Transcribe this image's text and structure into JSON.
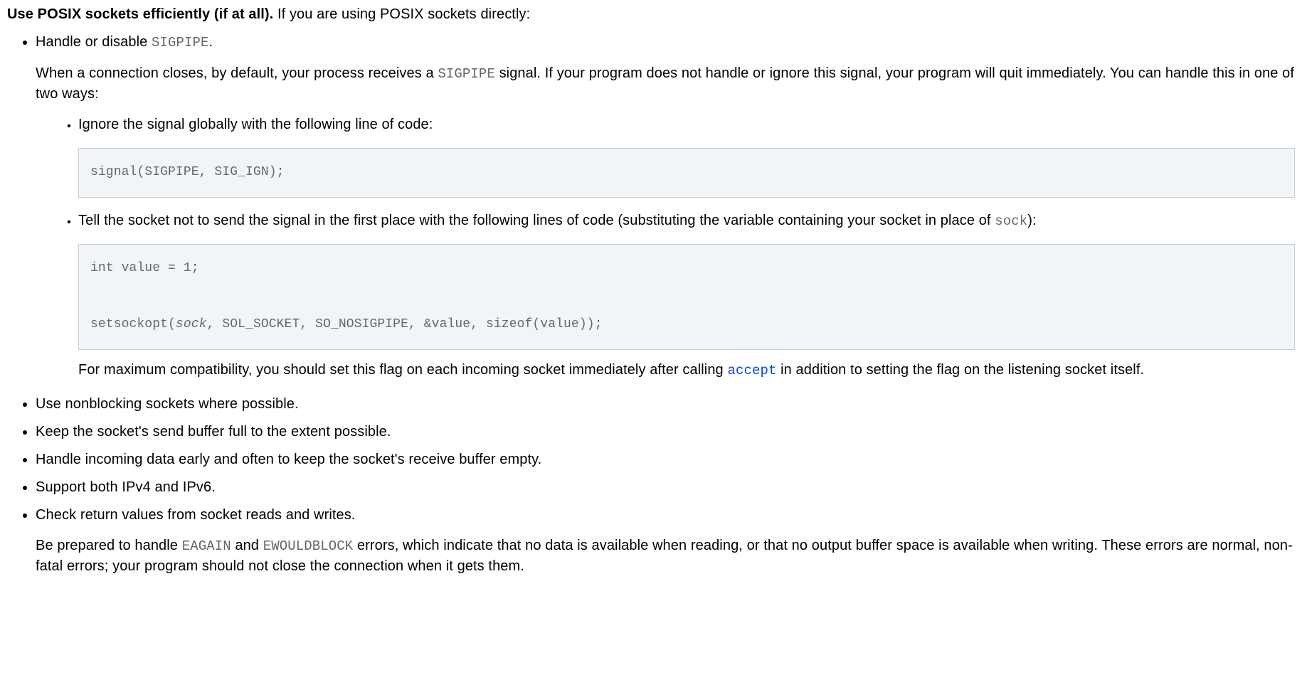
{
  "intro": {
    "bold": "Use POSIX sockets efficiently (if at all).",
    "rest": " If you are using POSIX sockets directly:"
  },
  "items": [
    {
      "lead_before": "Handle or disable ",
      "lead_code": "SIGPIPE",
      "lead_after": ".",
      "desc_before": "When a connection closes, by default, your process receives a ",
      "desc_code": "SIGPIPE",
      "desc_after": " signal. If your program does not handle or ignore this signal, your program will quit immediately. You can handle this in one of two ways:",
      "sub": [
        {
          "text": "Ignore the signal globally with the following line of code:",
          "code": "signal(SIGPIPE, SIG_IGN);"
        },
        {
          "text_before": "Tell the socket not to send the signal in the first place with the following lines of code (substituting the variable containing your socket in place of ",
          "text_code": "sock",
          "text_after": "):",
          "code_pre": "int value = 1;\n\nsetsockopt(",
          "code_italic": "sock",
          "code_post": ", SOL_SOCKET, SO_NOSIGPIPE, &value, sizeof(value));",
          "follow_before": "For maximum compatibility, you should set this flag on each incoming socket immediately after calling ",
          "follow_link": "accept",
          "follow_after": " in addition to setting the flag on the listening socket itself."
        }
      ]
    },
    {
      "text": "Use nonblocking sockets where possible."
    },
    {
      "text": "Keep the socket's send buffer full to the extent possible."
    },
    {
      "text": "Handle incoming data early and often to keep the socket's receive buffer empty."
    },
    {
      "text": "Support both IPv4 and IPv6."
    },
    {
      "text": "Check return values from socket reads and writes.",
      "desc_before": "Be prepared to handle ",
      "desc_code1": "EAGAIN",
      "desc_mid": " and ",
      "desc_code2": "EWOULDBLOCK",
      "desc_after": " errors, which indicate that no data is available when reading, or that no output buffer space is available when writing. These errors are normal, non-fatal errors; your program should not close the connection when it gets them."
    }
  ]
}
